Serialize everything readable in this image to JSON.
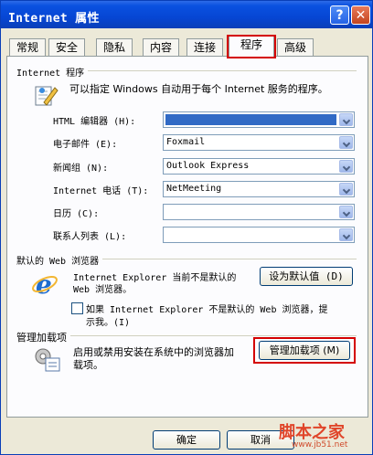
{
  "window": {
    "title": "Internet 属性",
    "help_glyph": "?",
    "close_glyph": "✕"
  },
  "tabs": [
    {
      "label": "常规",
      "active": false
    },
    {
      "label": "安全",
      "active": false
    },
    {
      "label": "隐私",
      "active": false
    },
    {
      "label": "内容",
      "active": false
    },
    {
      "label": "连接",
      "active": false
    },
    {
      "label": "程序",
      "active": true
    },
    {
      "label": "高级",
      "active": false
    }
  ],
  "programs": {
    "group_title": "Internet 程序",
    "description": "可以指定 Windows 自动用于每个 Internet 服务的程序。",
    "fields": [
      {
        "label": "HTML 编辑器 (H):",
        "value": ""
      },
      {
        "label": "电子邮件 (E):",
        "value": "Foxmail"
      },
      {
        "label": "新闻组 (N):",
        "value": "Outlook Express"
      },
      {
        "label": "Internet 电话 (T):",
        "value": "NetMeeting"
      },
      {
        "label": "日历 (C):",
        "value": ""
      },
      {
        "label": "联系人列表 (L):",
        "value": ""
      }
    ]
  },
  "default_browser": {
    "group_title": "默认的 Web 浏览器",
    "status_line1": "Internet Explorer 当前不是默认的",
    "status_line2": "Web 浏览器。",
    "set_default_button": "设为默认值 (D)",
    "check_line1": "如果 Internet Explorer 不是默认的 Web 浏览器，提",
    "check_line2": "示我。(I)",
    "checked": false
  },
  "addons": {
    "group_title": "管理加载项",
    "desc_line1": "启用或禁用安装在系统中的浏览器加",
    "desc_line2": "载项。",
    "manage_button": "管理加载项 (M)"
  },
  "footer": {
    "ok_button": "确定",
    "cancel_button": "取消"
  },
  "watermark": {
    "text": "脚本之家",
    "url": "www.jb51.net"
  },
  "colors": {
    "titlebar": "#0a51e0",
    "highlight": "#d40000",
    "selection": "#316ac5"
  }
}
